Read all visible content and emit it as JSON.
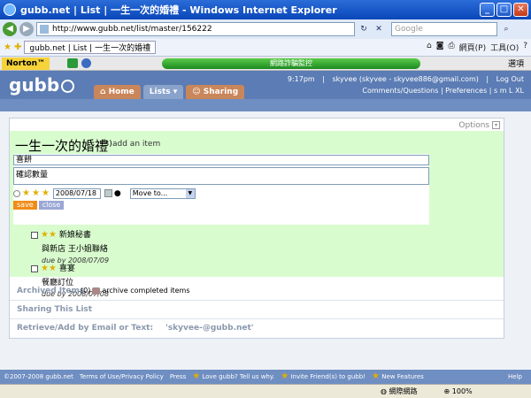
{
  "window": {
    "title": "gubb.net | List | 一生一次的婚禮 - Windows Internet Explorer",
    "min_label": "_",
    "max_label": "□",
    "close_label": "✕"
  },
  "address": {
    "url": "http://www.gubb.net/list/master/156222",
    "search_placeholder": "Google"
  },
  "tab": {
    "page_tab": "gubb.net | List | 一生一次的婚禮",
    "toolbar": {
      "page": "網頁(P)",
      "tools": "工具(O)",
      "help": "?"
    }
  },
  "norton": {
    "label": "Norton™",
    "bar_text": "網路詐騙監控",
    "options": "選項"
  },
  "gubb": {
    "logo": "gubb",
    "time": "9:17pm",
    "user": "skyvee (skyvee - skyvee886@gmail.com)",
    "logout": "Log Out",
    "links": "Comments/Questions  |  Preferences  |  s  m  L  XL",
    "nav": {
      "home": "Home",
      "lists": "Lists ▾",
      "sharing": "Sharing"
    }
  },
  "list": {
    "options": "Options",
    "title": "一生一次的婚禮",
    "count": "(3)",
    "add_item": "add an item",
    "field1": "喜餅",
    "field2": "確認數量",
    "date": "2008/07/18",
    "moveto": "Move to...",
    "save": "save",
    "close": "close",
    "items": [
      {
        "title": "新娘秘書",
        "sub": "與新店 王小姐聯絡",
        "due": "due by 2008/07/09"
      },
      {
        "title": "喜宴",
        "sub": "餐廳訂位",
        "due": "due by 2008/07/08"
      }
    ],
    "archived": "Archived Items",
    "archived_count": "(0)",
    "archive_action": "archive completed items",
    "sharing": "Sharing This List",
    "email_label": "Retrieve/Add by Email or Text:",
    "email_value": "'skyvee-@gubb.net'"
  },
  "footer": {
    "copy": "©2007-2008 gubb.net",
    "terms": "Terms of Use/Privacy Policy",
    "press": "Press",
    "love": "Love gubb? Tell us why.",
    "invite": "Invite Friend(s) to gubb!",
    "newf": "New Features",
    "help": "Help"
  },
  "status": {
    "net": "網際網路",
    "zoom": "100%"
  }
}
